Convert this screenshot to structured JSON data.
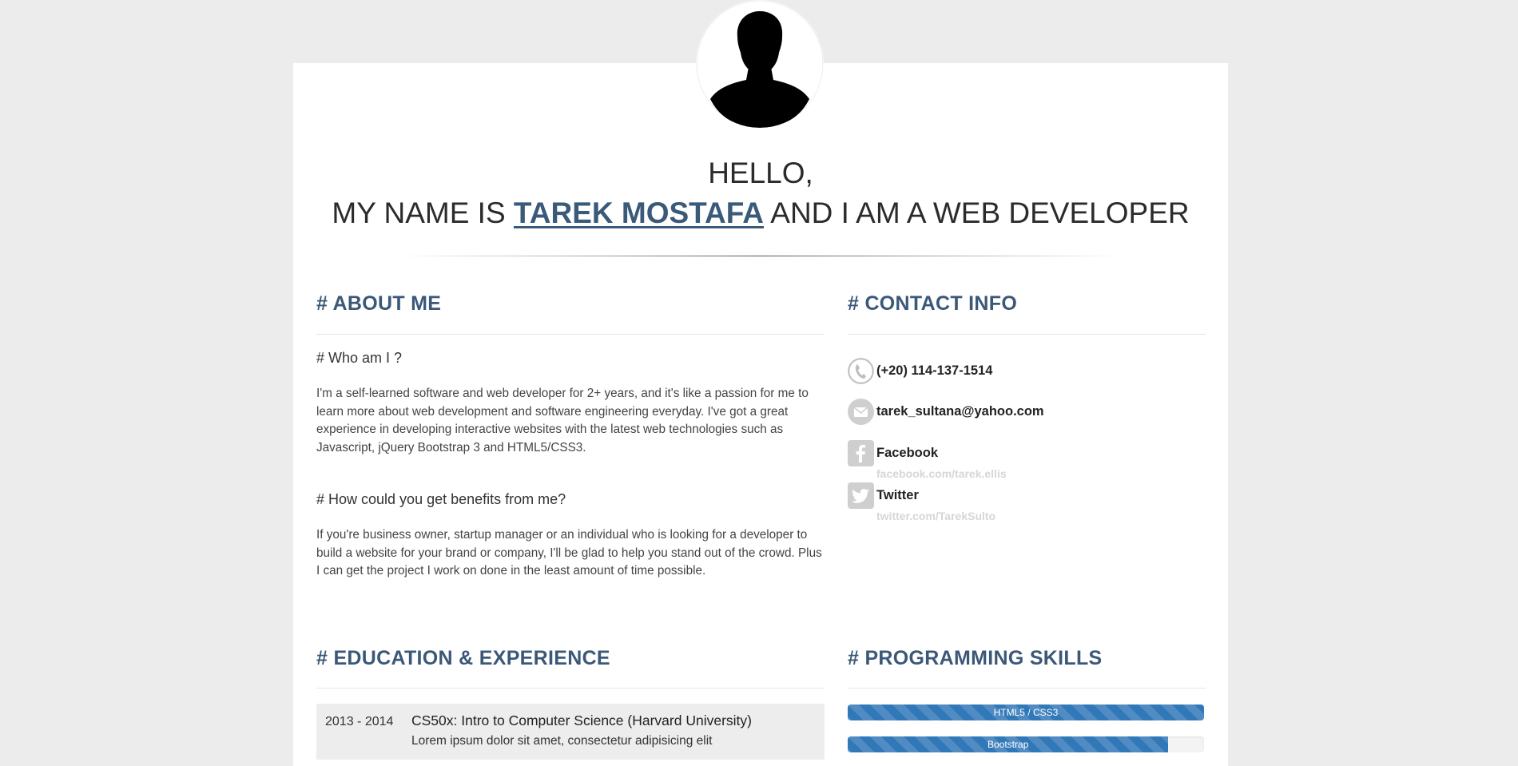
{
  "hero": {
    "line1": "HELLO,",
    "prefix": "MY NAME IS ",
    "name": "TAREK MOSTAFA",
    "suffix": " AND I AM A WEB DEVELOPER"
  },
  "about": {
    "title": "# ABOUT ME",
    "who_heading": "# Who am I ?",
    "who_text": "I'm a self-learned software and web developer for 2+ years, and it's like a passion for me to learn more about web development and software engineering everyday. I've got a great experience in developing interactive websites with the latest web technologies such as Javascript, jQuery Bootstrap 3 and HTML5/CSS3.",
    "benefits_heading": "# How could you get benefits from me?",
    "benefits_text": "If you're business owner, startup manager or an individual who is looking for a developer to build a website for your brand or company, I'll be glad to help you stand out of the crowd. Plus I can get the project I work on done in the least amount of time possible."
  },
  "contact": {
    "title": "# CONTACT INFO",
    "phone": "(+20) 114-137-1514",
    "email": "tarek_sultana@yahoo.com",
    "facebook_label": "Facebook",
    "facebook_link": "facebook.com/tarek.ellis",
    "twitter_label": "Twitter",
    "twitter_link": "twitter.com/TarekSulto",
    "icons": [
      "phone-icon",
      "envelope-icon",
      "facebook-icon",
      "twitter-icon"
    ]
  },
  "education": {
    "title": "# EDUCATION & EXPERIENCE",
    "items": [
      {
        "years": "2013 - 2014",
        "title": "CS50x: Intro to Computer Science (Harvard University)",
        "desc": "Lorem ipsum dolor sit amet, consectetur adipisicing elit"
      }
    ]
  },
  "skills": {
    "title": "# PROGRAMMING SKILLS",
    "items": [
      {
        "name": "HTML5 / CSS3",
        "level": 100
      },
      {
        "name": "Bootstrap",
        "level": 90
      }
    ]
  },
  "colors": {
    "accent": "#3b5878",
    "progress": "#3178b8",
    "page_bg": "#ececec",
    "icon_gray": "#cfcfcf"
  }
}
